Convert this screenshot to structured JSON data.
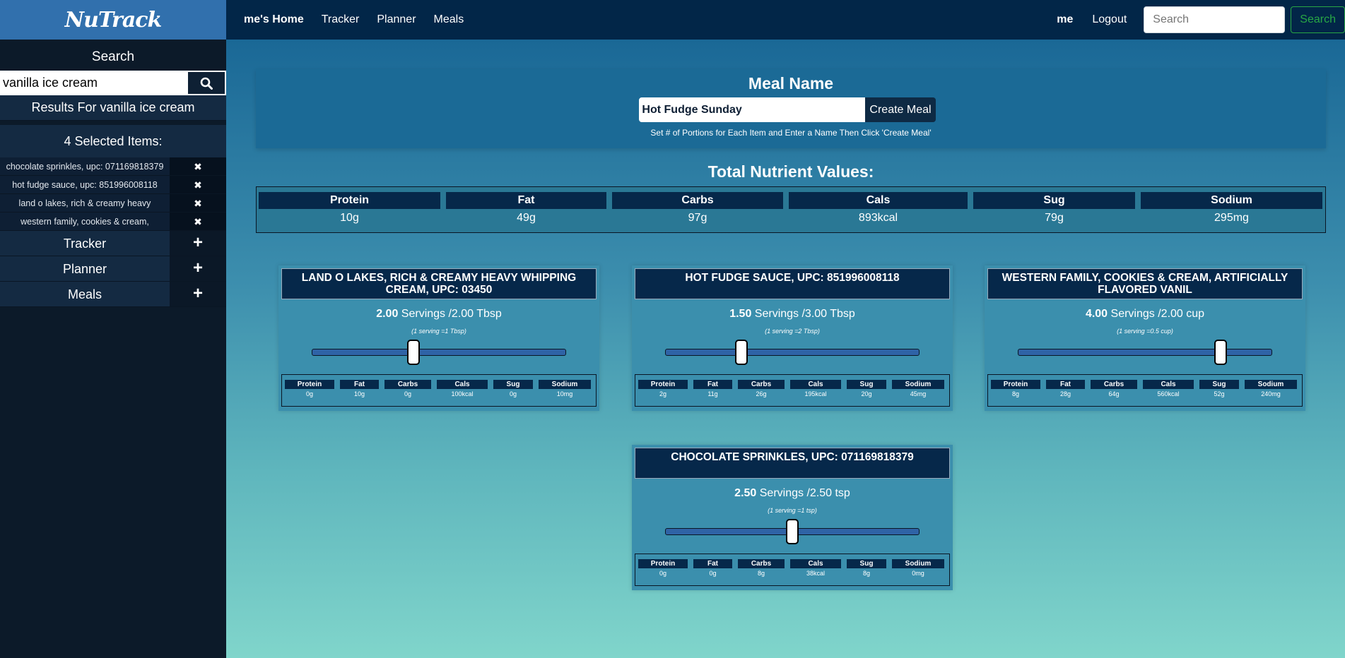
{
  "brand": "NuTrack",
  "sidebar": {
    "search_title": "Search",
    "search_value": "vanilla ice cream",
    "results_text": "Results For vanilla ice cream",
    "selected_title": "4 Selected Items:",
    "selected_items": [
      {
        "label": "chocolate sprinkles, upc: 071169818379",
        "remove": "✖"
      },
      {
        "label": "hot fudge sauce, upc: 851996008118",
        "remove": "✖"
      },
      {
        "label": "land o lakes, rich & creamy heavy",
        "remove": "✖"
      },
      {
        "label": "western family, cookies & cream,",
        "remove": "✖"
      }
    ],
    "nav": [
      {
        "label": "Tracker",
        "icon": "+"
      },
      {
        "label": "Planner",
        "icon": "+"
      },
      {
        "label": "Meals",
        "icon": "+"
      }
    ]
  },
  "topnav": {
    "home": "me's Home",
    "links": [
      "Tracker",
      "Planner",
      "Meals"
    ],
    "user": "me",
    "logout": "Logout",
    "search_placeholder": "Search",
    "search_button": "Search"
  },
  "meal": {
    "title": "Meal Name",
    "name_value": "Hot Fudge Sunday",
    "create_button": "Create Meal",
    "hint": "Set # of Portions for Each Item and Enter a Name Then Click 'Create Meal'"
  },
  "totals": {
    "title": "Total Nutrient Values:",
    "headers": [
      "Protein",
      "Fat",
      "Carbs",
      "Cals",
      "Sug",
      "Sodium"
    ],
    "values": [
      "10g",
      "49g",
      "97g",
      "893kcal",
      "79g",
      "295mg"
    ]
  },
  "items": [
    {
      "title": "LAND O LAKES, RICH & CREAMY HEAVY WHIPPING CREAM, UPC: 03450",
      "servings": "2.00",
      "servings_suffix": " Servings /2.00 Tbsp",
      "conversion": "(1 serving =1 Tbsp)",
      "slider_fraction": 0.4,
      "nutrients": [
        "0g",
        "10g",
        "0g",
        "100kcal",
        "0g",
        "10mg"
      ]
    },
    {
      "title": "HOT FUDGE SAUCE, UPC: 851996008118",
      "servings": "1.50",
      "servings_suffix": " Servings /3.00 Tbsp",
      "conversion": "(1 serving =2 Tbsp)",
      "slider_fraction": 0.3,
      "nutrients": [
        "2g",
        "11g",
        "26g",
        "195kcal",
        "20g",
        "45mg"
      ]
    },
    {
      "title": "WESTERN FAMILY, COOKIES & CREAM, ARTIFICIALLY FLAVORED VANIL",
      "servings": "4.00",
      "servings_suffix": " Servings /2.00 cup",
      "conversion": "(1 serving =0.5 cup)",
      "slider_fraction": 0.8,
      "nutrients": [
        "8g",
        "28g",
        "64g",
        "560kcal",
        "52g",
        "240mg"
      ]
    },
    {
      "title": "CHOCOLATE SPRINKLES, UPC: 071169818379",
      "servings": "2.50",
      "servings_suffix": " Servings /2.50 tsp",
      "conversion": "(1 serving =1 tsp)",
      "slider_fraction": 0.5,
      "nutrients": [
        "0g",
        "0g",
        "8g",
        "38kcal",
        "8g",
        "0mg"
      ]
    }
  ],
  "colors": {
    "brand_bg": "#3170ad",
    "topnav_bg": "#022648",
    "header_cell": "#06284a",
    "search_btn": "#28a745"
  }
}
